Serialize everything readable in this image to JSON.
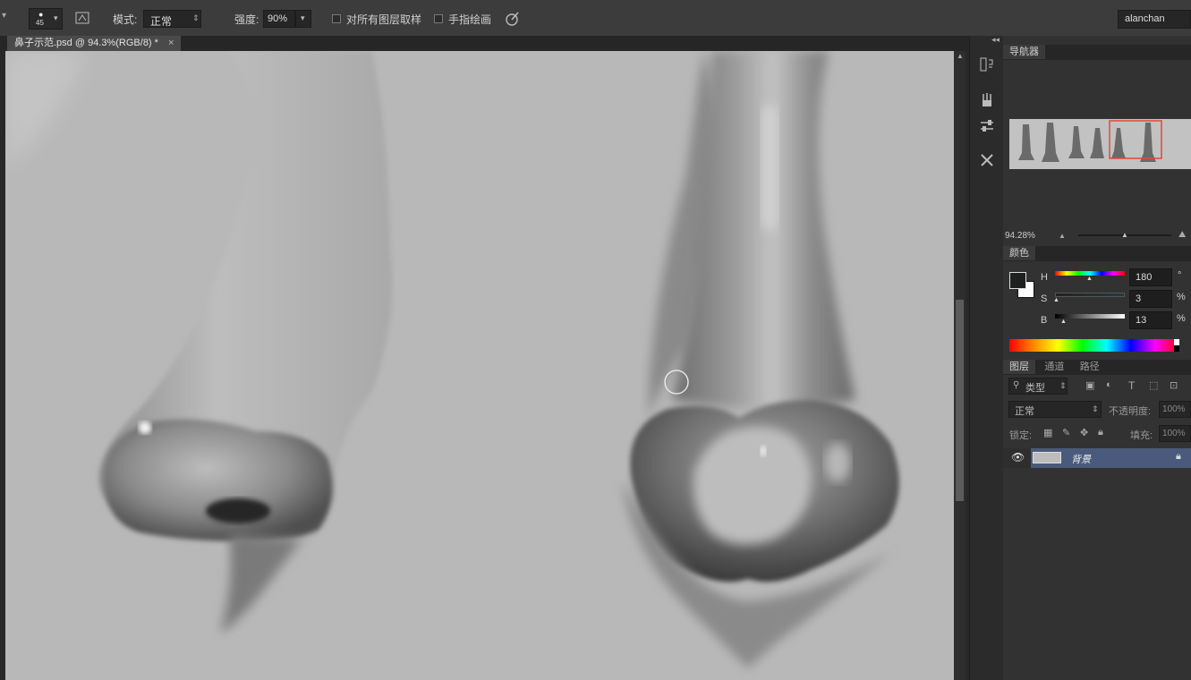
{
  "options_bar": {
    "brush_size": "45",
    "mode_label": "模式:",
    "mode_value": "正常",
    "strength_label": "强度:",
    "strength_value": "90%",
    "sample_all_layers_label": "对所有图层取样",
    "finger_painting_label": "手指绘画",
    "user_name": "alanchan"
  },
  "document": {
    "tab_title": "鼻子示范.psd @ 94.3%(RGB/8) *",
    "close_glyph": "×"
  },
  "navigator": {
    "tab_label": "导航器",
    "zoom_value": "94.28%"
  },
  "color_panel": {
    "tab_label": "颜色",
    "h_label": "H",
    "h_value": "180",
    "h_unit": "°",
    "s_label": "S",
    "s_value": "3",
    "s_unit": "%",
    "b_label": "B",
    "b_value": "13",
    "b_unit": "%"
  },
  "layers_panel": {
    "tabs": [
      "图层",
      "通道",
      "路径"
    ],
    "filter_kind": "类型",
    "blend_mode": "正常",
    "opacity_label": "不透明度:",
    "opacity_value": "100%",
    "lock_label": "锁定:",
    "fill_label": "填充:",
    "fill_value": "100%",
    "layers": [
      {
        "name": "背景",
        "locked": true,
        "visible": true
      }
    ]
  },
  "colors": {
    "ui_bg": "#323232",
    "canvas_bg": "#b6b6b6",
    "selected_layer": "#4a5a7c",
    "navigator_box": "#e04a3a",
    "foreground_swatch": "#1f2121",
    "background_swatch": "#ffffff"
  }
}
